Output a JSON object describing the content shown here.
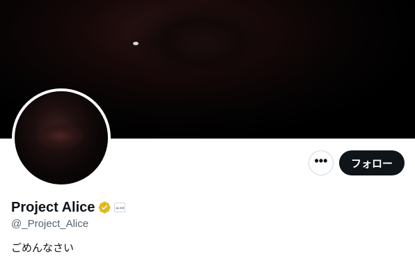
{
  "profile": {
    "display_name": "Project Alice",
    "handle": "@_Project_Alice",
    "bio": "ごめんなさい",
    "verified_badge_color": "#e2b719",
    "affiliate_badge_text": "ALICE"
  },
  "actions": {
    "more_label": "•••",
    "follow_label": "フォロー"
  },
  "colors": {
    "follow_button_bg": "#0f1419",
    "handle_text": "#536471",
    "border": "#cfd9de"
  },
  "icons": {
    "more": "more-horizontal-icon",
    "verified": "verified-badge-icon",
    "affiliate": "affiliate-badge-icon"
  }
}
